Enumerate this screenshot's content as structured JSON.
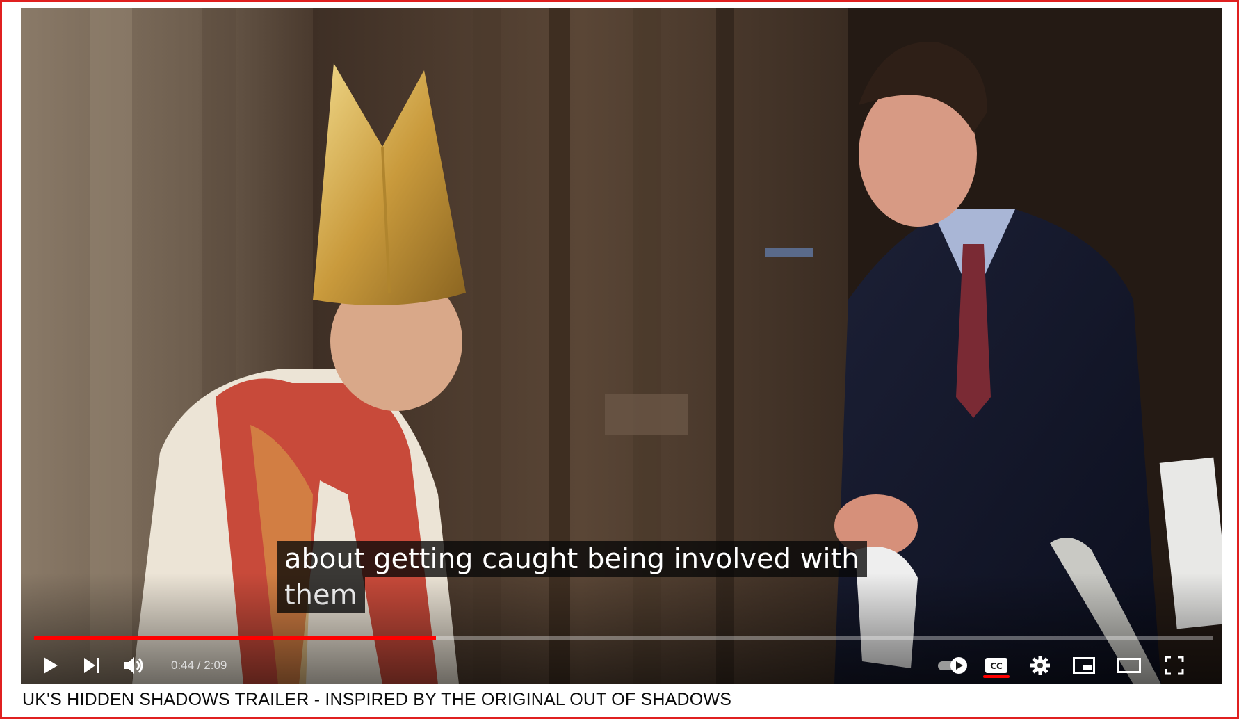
{
  "player": {
    "subtitle_lines": [
      "about getting caught being involved with",
      "them"
    ],
    "time_current": "0:44",
    "time_separator": " / ",
    "time_total": "2:09",
    "progress_fraction": 0.341,
    "accent_color": "#ff0000",
    "controls": {
      "play": "play-icon",
      "next": "next-icon",
      "volume": "volume-icon",
      "autoplay": "autoplay-toggle-icon",
      "captions": "cc-icon",
      "settings": "gear-icon",
      "miniplayer": "miniplayer-icon",
      "theater": "theater-mode-icon",
      "fullscreen": "fullscreen-icon"
    }
  },
  "video": {
    "title": "UK'S HIDDEN SHADOWS TRAILER - INSPIRED BY THE ORIGINAL OUT OF SHADOWS"
  }
}
